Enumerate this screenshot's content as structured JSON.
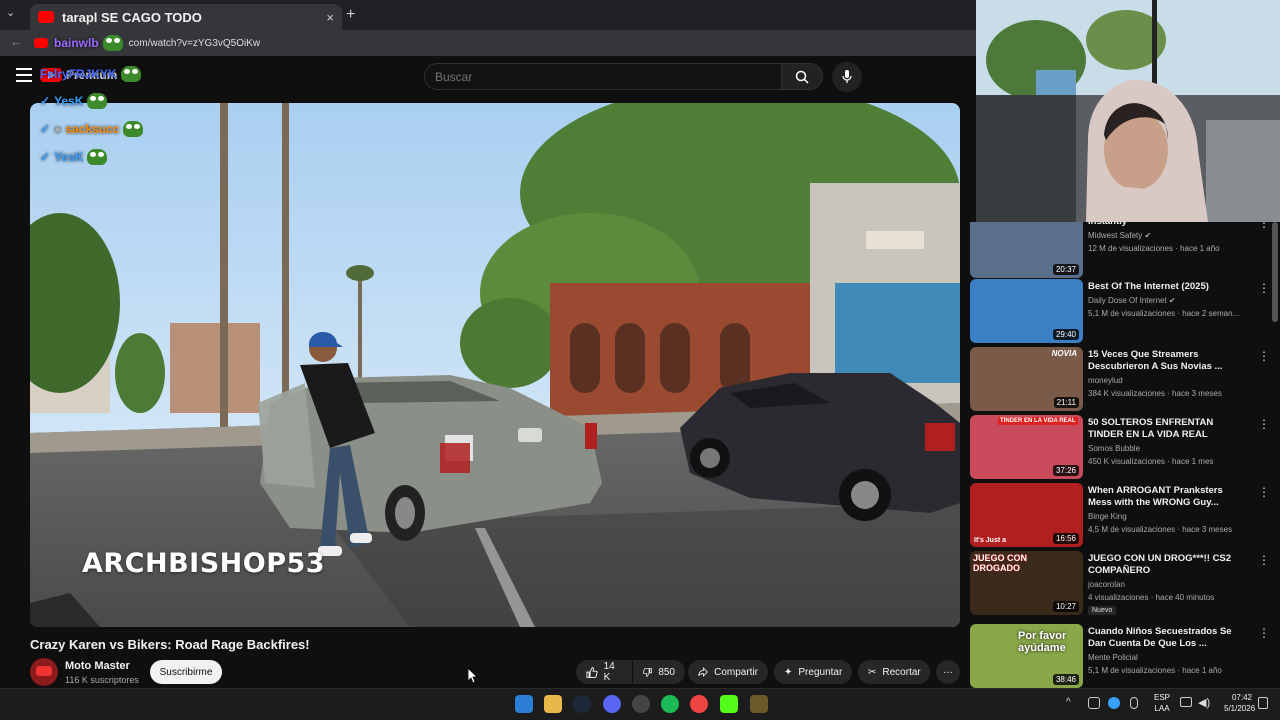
{
  "browser": {
    "tab_title": "tarapl  SE CAGO TODO",
    "tab_close": "×",
    "new_tab": "+",
    "url": "com/watch?v=zYG3vQ5OiKw"
  },
  "header": {
    "logo_text": "Premium",
    "search_placeholder": "Buscar"
  },
  "chat_overlay": [
    {
      "user": "FelryFRJKYK",
      "color": "#4a6cff"
    },
    {
      "user": "YesK",
      "color": "#3aa0ff"
    },
    {
      "user": "sacksucc",
      "color": "#ff8c00"
    },
    {
      "user": "YesK",
      "color": "#3aa0ff"
    }
  ],
  "chat_overlay_extra": {
    "user": "bainwlb",
    "color": "#8a2be2"
  },
  "video": {
    "watermark": "ARCHBISHOP53",
    "title": "Crazy Karen vs Bikers: Road Rage Backfires!",
    "channel": "Moto Master",
    "subscribers": "116 K suscriptores",
    "subscribe_label": "Suscribirme",
    "likes": "14 K",
    "dislikes": "850",
    "share_label": "Compartir",
    "ask_label": "Preguntar",
    "clip_label": "Recortar",
    "more_label": "···"
  },
  "recommendations": [
    {
      "title": "Instantly",
      "channel": "Midwest Safety",
      "verified": true,
      "meta": "12 M de visualizaciones · hace 1 año",
      "duration": "20:37",
      "thumb_color": "#5a6f8a"
    },
    {
      "title": "Best Of The Internet (2025)",
      "channel": "Daily Dose Of Internet",
      "verified": true,
      "meta": "5,1 M de visualizaciones · hace 2 seman...",
      "duration": "29:40",
      "thumb_color": "#3b7fc4"
    },
    {
      "title": "15 Veces Que Streamers Descubrieron A Sus Novias ...",
      "channel": "moneylud",
      "verified": false,
      "meta": "384 K visualizaciones · hace 3 meses",
      "duration": "21:11",
      "thumb_color": "#7a5a48"
    },
    {
      "title": "50 SOLTEROS ENFRENTAN TINDER EN LA VIDA REAL",
      "channel": "Somos Bubble",
      "verified": false,
      "meta": "450 K visualizaciones · hace 1 mes",
      "duration": "37:26",
      "thumb_color": "#c94a5a"
    },
    {
      "title": "When ARROGANT Pranksters Mess with the WRONG Guy...",
      "channel": "Binge King",
      "verified": false,
      "meta": "4,5 M de visualizaciones · hace 3 meses",
      "duration": "16:56",
      "thumb_color": "#b02020"
    },
    {
      "title": "JUEGO CON UN DROG***!! CS2 COMPAÑERO",
      "channel": "joacorolan",
      "verified": false,
      "meta": "4 visualizaciones · hace 40 minutos",
      "duration": "10:27",
      "thumb_color": "#3a2a1a",
      "badge": "Nuevo"
    },
    {
      "title": "Cuando Niños Secuestrados Se Dan Cuenta De Que Los ...",
      "channel": "Mente Policial",
      "verified": false,
      "meta": "5,1 M de visualizaciones · hace 1 año",
      "duration": "38:46",
      "thumb_color": "#8aa84a"
    }
  ],
  "thumb_texts": {
    "novia": "NOVIA",
    "tinder": "TINDER EN LA VIDA REAL",
    "juego": "JUEGO CON DROGADO",
    "porfavor": "Por favor ayúdame",
    "itsjust": "It's Just a"
  },
  "taskbar": {
    "lang_top": "ESP",
    "lang_bottom": "LAA",
    "time": "07:42",
    "date": "5/1/2026"
  }
}
